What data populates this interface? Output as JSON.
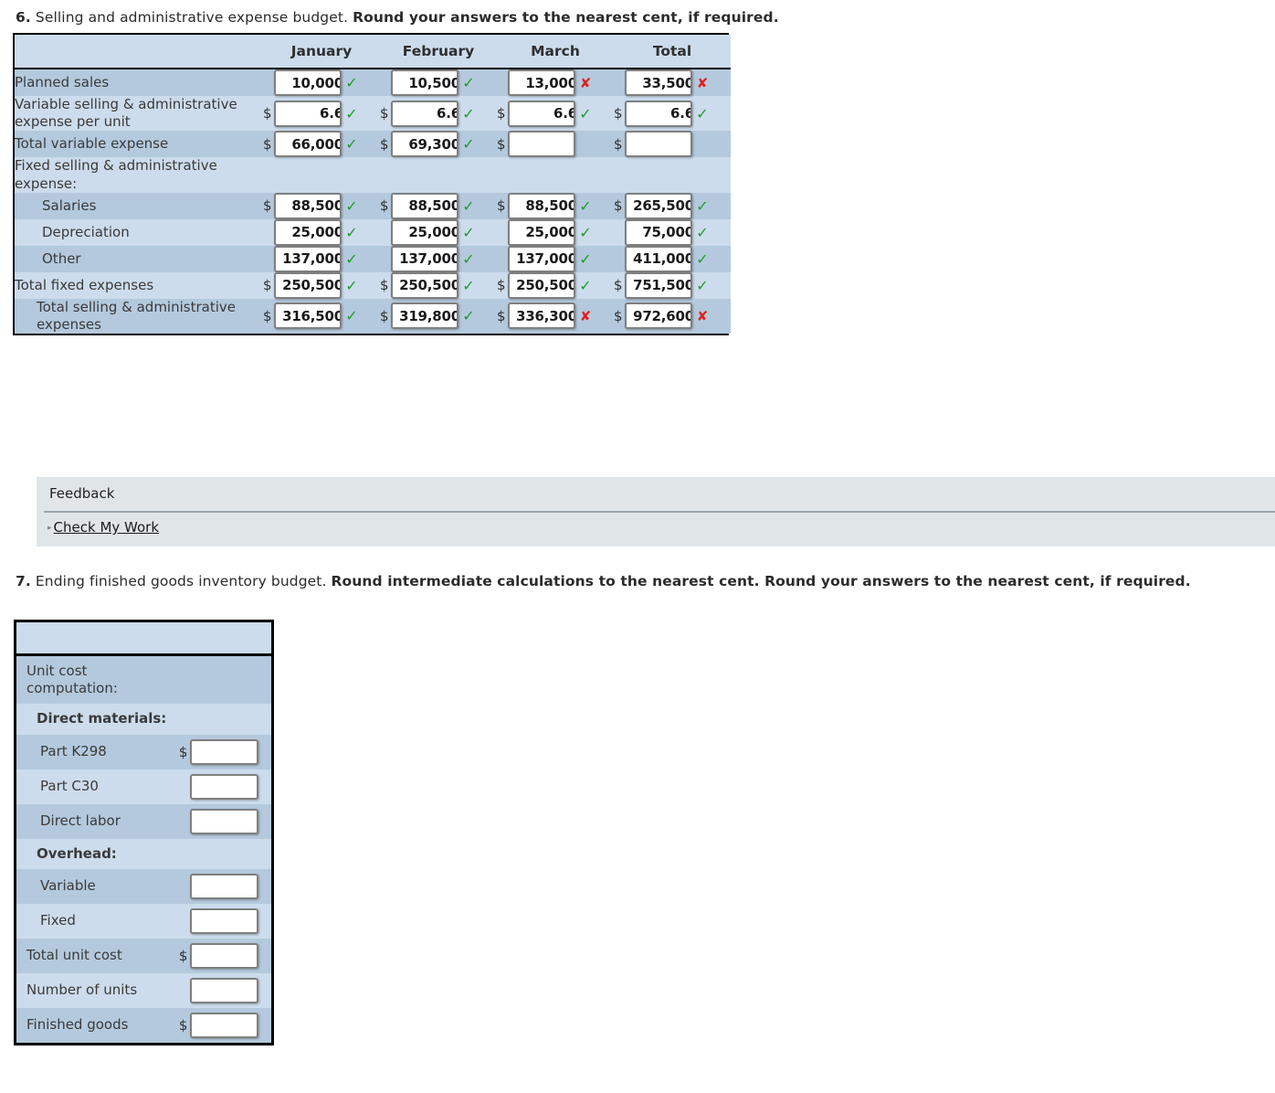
{
  "questions": {
    "q6": {
      "number": "6.",
      "title": " Selling and administrative expense budget. ",
      "instruction": "Round your answers to the nearest cent, if required."
    },
    "q7": {
      "number": "7.",
      "title": " Ending finished goods inventory budget. ",
      "instruction": "Round intermediate calculations to the nearest cent. Round your answers to the nearest cent, if required."
    }
  },
  "budget_table": {
    "headers": [
      "",
      "January",
      "February",
      "March",
      "Total"
    ],
    "rows": [
      {
        "label": "Planned sales",
        "cells": [
          {
            "dollar": false,
            "value": "10,000",
            "mark": "correct"
          },
          {
            "dollar": false,
            "value": "10,500",
            "mark": "correct"
          },
          {
            "dollar": false,
            "value": "13,000",
            "mark": "wrong"
          },
          {
            "dollar": false,
            "value": "33,500",
            "mark": "wrong"
          }
        ]
      },
      {
        "label": "Variable selling & administrative expense per unit",
        "cells": [
          {
            "dollar": true,
            "value": "6.6",
            "mark": "correct"
          },
          {
            "dollar": true,
            "value": "6.6",
            "mark": "correct"
          },
          {
            "dollar": true,
            "value": "6.6",
            "mark": "correct"
          },
          {
            "dollar": true,
            "value": "6.6",
            "mark": "correct"
          }
        ]
      },
      {
        "label": "Total variable expense",
        "cells": [
          {
            "dollar": true,
            "value": "66,000",
            "mark": "correct"
          },
          {
            "dollar": true,
            "value": "69,300",
            "mark": "correct"
          },
          {
            "dollar": true,
            "value": "",
            "mark": "none"
          },
          {
            "dollar": true,
            "value": "",
            "mark": "none"
          }
        ]
      },
      {
        "label": "Fixed selling & administrative expense:",
        "cells": [
          {
            "dollar": false,
            "value": null,
            "mark": "none"
          },
          {
            "dollar": false,
            "value": null,
            "mark": "none"
          },
          {
            "dollar": false,
            "value": null,
            "mark": "none"
          },
          {
            "dollar": false,
            "value": null,
            "mark": "none"
          }
        ]
      },
      {
        "label": "Salaries",
        "indent": true,
        "cells": [
          {
            "dollar": true,
            "value": "88,500",
            "mark": "correct"
          },
          {
            "dollar": true,
            "value": "88,500",
            "mark": "correct"
          },
          {
            "dollar": true,
            "value": "88,500",
            "mark": "correct"
          },
          {
            "dollar": true,
            "value": "265,500",
            "mark": "correct"
          }
        ]
      },
      {
        "label": "Depreciation",
        "indent": true,
        "cells": [
          {
            "dollar": false,
            "value": "25,000",
            "mark": "correct"
          },
          {
            "dollar": false,
            "value": "25,000",
            "mark": "correct"
          },
          {
            "dollar": false,
            "value": "25,000",
            "mark": "correct"
          },
          {
            "dollar": false,
            "value": "75,000",
            "mark": "correct"
          }
        ]
      },
      {
        "label": "Other",
        "indent": true,
        "cells": [
          {
            "dollar": false,
            "value": "137,000",
            "mark": "correct"
          },
          {
            "dollar": false,
            "value": "137,000",
            "mark": "correct"
          },
          {
            "dollar": false,
            "value": "137,000",
            "mark": "correct"
          },
          {
            "dollar": false,
            "value": "411,000",
            "mark": "correct"
          }
        ]
      },
      {
        "label": "Total fixed expenses",
        "cells": [
          {
            "dollar": true,
            "value": "250,500",
            "mark": "correct"
          },
          {
            "dollar": true,
            "value": "250,500",
            "mark": "correct"
          },
          {
            "dollar": true,
            "value": "250,500",
            "mark": "correct"
          },
          {
            "dollar": true,
            "value": "751,500",
            "mark": "correct"
          }
        ]
      },
      {
        "label": "Total selling & administrative expenses",
        "indent_first_line": true,
        "cells": [
          {
            "dollar": true,
            "value": "316,500",
            "mark": "correct"
          },
          {
            "dollar": true,
            "value": "319,800",
            "mark": "correct"
          },
          {
            "dollar": true,
            "value": "336,300",
            "mark": "wrong"
          },
          {
            "dollar": true,
            "value": "972,600",
            "mark": "wrong"
          }
        ]
      }
    ]
  },
  "feedback": {
    "title": "Feedback",
    "check_my_work": "Check My Work",
    "triangle": "▸"
  },
  "unit_cost_table": {
    "rows": [
      {
        "label": "Unit cost computation:",
        "style": "plain",
        "input": false,
        "dollar": false
      },
      {
        "label": "Direct materials:",
        "style": "bold",
        "input": false,
        "dollar": false
      },
      {
        "label": "Part K298",
        "style": "sub",
        "input": true,
        "dollar": true,
        "value": ""
      },
      {
        "label": "Part C30",
        "style": "sub",
        "input": true,
        "dollar": false,
        "value": ""
      },
      {
        "label": "Direct labor",
        "style": "sub",
        "input": true,
        "dollar": false,
        "value": ""
      },
      {
        "label": "Overhead:",
        "style": "bold",
        "input": false,
        "dollar": false
      },
      {
        "label": "Variable",
        "style": "sub",
        "input": true,
        "dollar": false,
        "value": ""
      },
      {
        "label": "Fixed",
        "style": "sub",
        "input": true,
        "dollar": false,
        "value": ""
      },
      {
        "label": "Total unit cost",
        "style": "plain",
        "input": true,
        "dollar": true,
        "value": ""
      },
      {
        "label": "Number of units",
        "style": "plain",
        "input": true,
        "dollar": false,
        "value": ""
      },
      {
        "label": "Finished goods",
        "style": "plain",
        "input": true,
        "dollar": true,
        "value": ""
      }
    ]
  },
  "colors": {
    "row_dark": "#b4c9dd",
    "row_light": "#ccdcec",
    "border": "#000000",
    "correct": "#1f9b2e",
    "wrong": "#e02020",
    "feedback_bg": "#e0e6e8"
  },
  "icons": {
    "correct": "✓",
    "wrong": "✘",
    "dollar": "$"
  }
}
